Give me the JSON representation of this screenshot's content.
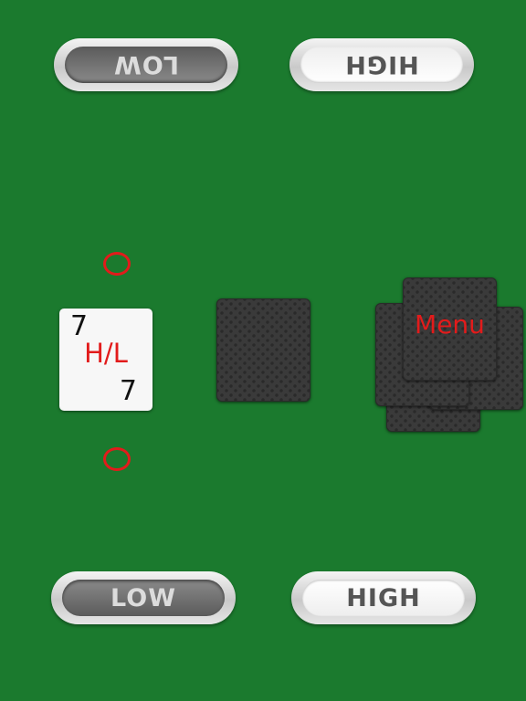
{
  "top_controls": {
    "low_label": "LOW",
    "high_label": "HIGH"
  },
  "bottom_controls": {
    "low_label": "LOW",
    "high_label": "HIGH"
  },
  "current_card": {
    "rank_top": "7",
    "center_label": "H/L",
    "rank_bottom": "7"
  },
  "menu": {
    "label": "Menu"
  },
  "colors": {
    "table": "#1b7a2e",
    "accent": "#e21b1b",
    "card_back": "#3a3a3a"
  }
}
